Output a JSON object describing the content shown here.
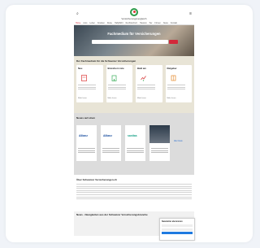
{
  "site": {
    "logo_text": "Versicherungsvergleich",
    "search_icon": "search-icon",
    "menu_icon": "menu-icon"
  },
  "nav": [
    "Home",
    "Auto",
    "Leben",
    "Kranken",
    "Reise",
    "Haftpflicht",
    "Rechtsschutz",
    "Hausrat",
    "Tier",
    "Firmen",
    "News",
    "Kontakt"
  ],
  "hero": {
    "title": "Fachmedium für Versicherungen",
    "search_placeholder": "",
    "button_label": ""
  },
  "overview": {
    "title": "Der Fachmedium für die Schweizer Versicherungen",
    "tiles": [
      {
        "title": "Neu",
        "icon": "document-icon",
        "color": "#e05050"
      },
      {
        "title": "Branchen Liste",
        "icon": "building-icon",
        "color": "#4fb66b"
      },
      {
        "title": "Bald am",
        "icon": "chart-icon",
        "color": "#d94545"
      },
      {
        "title": "Ratgeber",
        "icon": "book-icon",
        "color": "#e69540"
      }
    ],
    "link_text": "Mehr lesen"
  },
  "news": {
    "title": "Neues auf einen",
    "cards": [
      {
        "logo": "Allianz",
        "logo_color": "#1a4fa0"
      },
      {
        "logo": "Allianz",
        "logo_color": "#1a4fa0"
      },
      {
        "logo": "sanitas",
        "logo_color": "#1ca38a"
      },
      {
        "logo": "",
        "logo_color": ""
      }
    ],
    "more": "Alle News"
  },
  "about": {
    "title": "Über Schweizer Versicherungen.ch"
  },
  "footer": {
    "title": "News - Neuigkeiten aus der Schweizer Versicherungsbranche"
  },
  "popup": {
    "title": "Newsletter abonnieren"
  },
  "colors": {
    "accent": "#d3283a",
    "link": "#2a6fd0",
    "overview_bg": "#e8e4d6",
    "news_bg": "#dcdcdc"
  }
}
